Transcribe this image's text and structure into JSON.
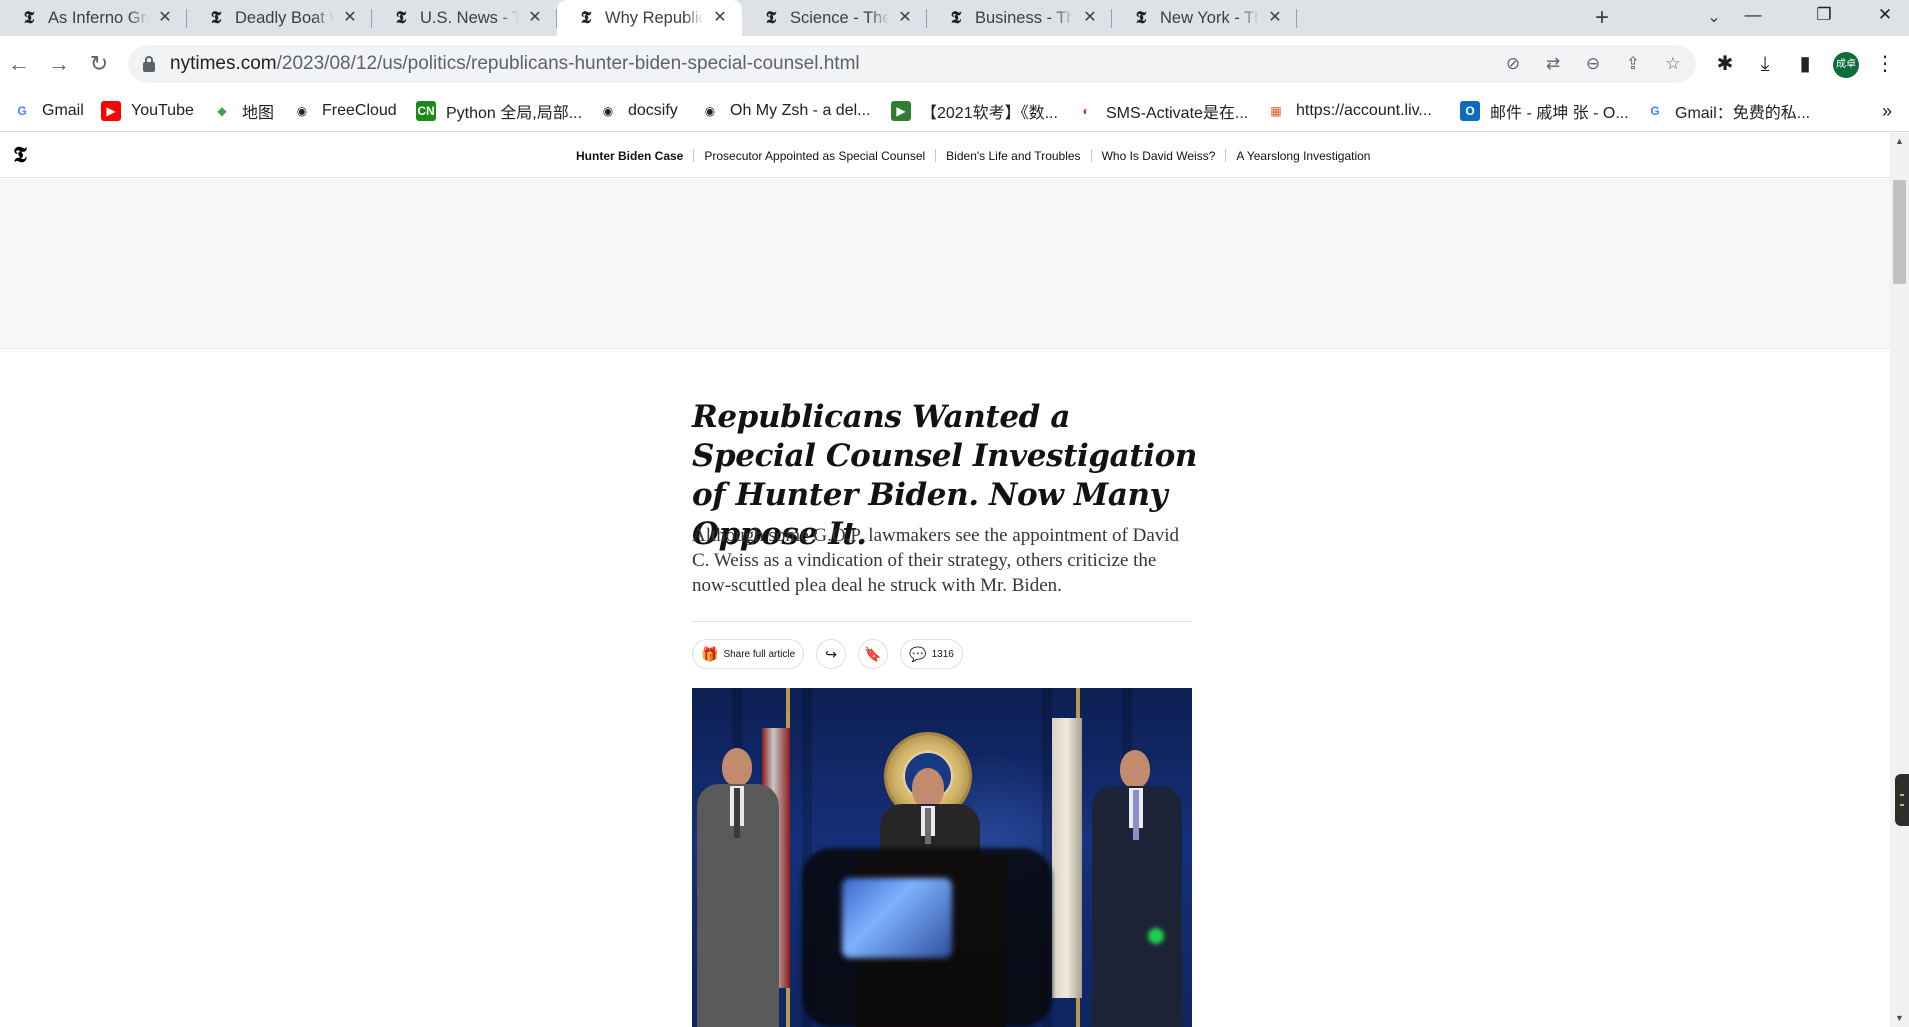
{
  "browser": {
    "tabs": [
      {
        "title": "As Inferno Grew, Lahaina",
        "active": false
      },
      {
        "title": "Deadly Boat Wreck in",
        "active": false
      },
      {
        "title": "U.S. News - The New York",
        "active": false
      },
      {
        "title": "Why Republicans Soured",
        "active": true
      },
      {
        "title": "Science - The New York",
        "active": false
      },
      {
        "title": "Business - The New York",
        "active": false
      },
      {
        "title": "New York - The New York",
        "active": false
      }
    ],
    "favicon_glyph": "𝕿",
    "close_glyph": "✕",
    "new_tab_glyph": "+",
    "tab_search_glyph": "⌄",
    "window": {
      "minimize": "—",
      "restore": "❐",
      "close": "✕"
    },
    "address": {
      "host": "nytimes.com",
      "path": "/2023/08/12/us/politics/republicans-hunter-biden-special-counsel.html"
    },
    "nav": {
      "back": "←",
      "forward": "→",
      "reload": "↻"
    },
    "omnibox_icons": {
      "translate_blocked": "⊘",
      "translate": "⇄",
      "zoom": "⊖",
      "share": "⇪",
      "bookmark_star": "☆"
    },
    "toolbar_icons": {
      "extensions": "✱",
      "downloads": "⤓",
      "side_panel": "▮",
      "menu": "⋮"
    },
    "profile_initials": "成卓",
    "bookmarks": [
      {
        "label": "Gmail",
        "icon": "G",
        "icon_color": "#4285f4",
        "icon_bg": "#ffffff"
      },
      {
        "label": "YouTube",
        "icon": "▶",
        "icon_color": "#ffffff",
        "icon_bg": "#ff0000"
      },
      {
        "label": "地图",
        "icon": "◆",
        "icon_color": "#34a853",
        "icon_bg": "#ffffff"
      },
      {
        "label": "FreeCloud",
        "icon": "◉",
        "icon_color": "#202124",
        "icon_bg": "#ffffff"
      },
      {
        "label": "Python 全局,局部...",
        "icon": "CN",
        "icon_color": "#ffffff",
        "icon_bg": "#1a8a1a"
      },
      {
        "label": "docsify",
        "icon": "◉",
        "icon_color": "#202124",
        "icon_bg": "#ffffff"
      },
      {
        "label": "Oh My Zsh - a del...",
        "icon": "◉",
        "icon_color": "#202124",
        "icon_bg": "#ffffff"
      },
      {
        "label": "【2021软考】《数...",
        "icon": "▶",
        "icon_color": "#ffffff",
        "icon_bg": "#2e7d32"
      },
      {
        "label": "SMS-Activate是在...",
        "icon": "◐",
        "icon_color": "#c0392b",
        "icon_bg": "#ffffff"
      },
      {
        "label": "https://account.liv...",
        "icon": "▦",
        "icon_color": "#f25022",
        "icon_bg": "#ffffff"
      },
      {
        "label": "邮件 - 戚坤 张 - O...",
        "icon": "O",
        "icon_color": "#ffffff",
        "icon_bg": "#0f6cbd"
      },
      {
        "label": "Gmail：免费的私...",
        "icon": "G",
        "icon_color": "#4285f4",
        "icon_bg": "#ffffff"
      }
    ],
    "bookmarks_more": "»"
  },
  "page": {
    "logo": "𝕿",
    "nav_links": [
      {
        "label": "Hunter Biden Case",
        "bold": true
      },
      {
        "label": "Prosecutor Appointed as Special Counsel",
        "bold": false
      },
      {
        "label": "Biden's Life and Troubles",
        "bold": false
      },
      {
        "label": "Who Is David Weiss?",
        "bold": false
      },
      {
        "label": "A Yearslong Investigation",
        "bold": false
      }
    ],
    "headline": "Republicans Wanted a Special Counsel Investigation of Hunter Biden. Now Many Oppose It.",
    "summary": "Although some G.O.P. lawmakers see the appointment of David C. Weiss as a vindication of their strategy, others criticize the now-scuttled plea deal he struck with Mr. Biden.",
    "actions": {
      "share_label": "Share full article",
      "share_icon": "🎁",
      "forward_icon": "↪",
      "save_icon": "🔖",
      "comments_icon": "💬",
      "comments_count": "1316"
    },
    "photo_alt_subject": "press-conference-department-of-justice"
  },
  "scrollbar": {
    "up": "▲",
    "down": "▼",
    "position": 0.04
  }
}
